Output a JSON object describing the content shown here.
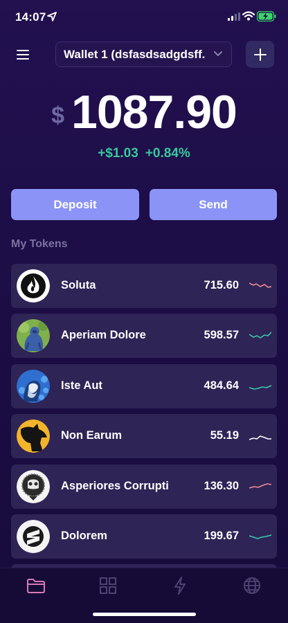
{
  "status_bar": {
    "time": "14:07"
  },
  "header": {
    "wallet_name": "Wallet 1 (dsfasdsadgdsff..."
  },
  "balance": {
    "currency": "$",
    "value": "1087.90",
    "change_abs": "+$1.03",
    "change_pct": "+0.84%"
  },
  "actions": {
    "deposit_label": "Deposit",
    "send_label": "Send"
  },
  "tokens_section": {
    "title": "My Tokens"
  },
  "tokens": [
    {
      "name": "Soluta",
      "value": "715.60",
      "trend": "down"
    },
    {
      "name": "Aperiam Dolore",
      "value": "598.57",
      "trend": "up"
    },
    {
      "name": "Iste Aut",
      "value": "484.64",
      "trend": "up"
    },
    {
      "name": "Non Earum",
      "value": "55.19",
      "trend": "flat"
    },
    {
      "name": "Asperiores Corrupti",
      "value": "136.30",
      "trend": "up"
    },
    {
      "name": "Dolorem",
      "value": "199.67",
      "trend": "up"
    }
  ],
  "colors": {
    "accent": "#8b94f6",
    "positive": "#38c99b",
    "negative": "#f08a9a",
    "active_tab": "#d87ab8"
  },
  "tab_bar": {
    "active": "wallet-tab",
    "icons": [
      "folder-icon",
      "grid-icon",
      "lightning-icon",
      "globe-icon"
    ]
  }
}
